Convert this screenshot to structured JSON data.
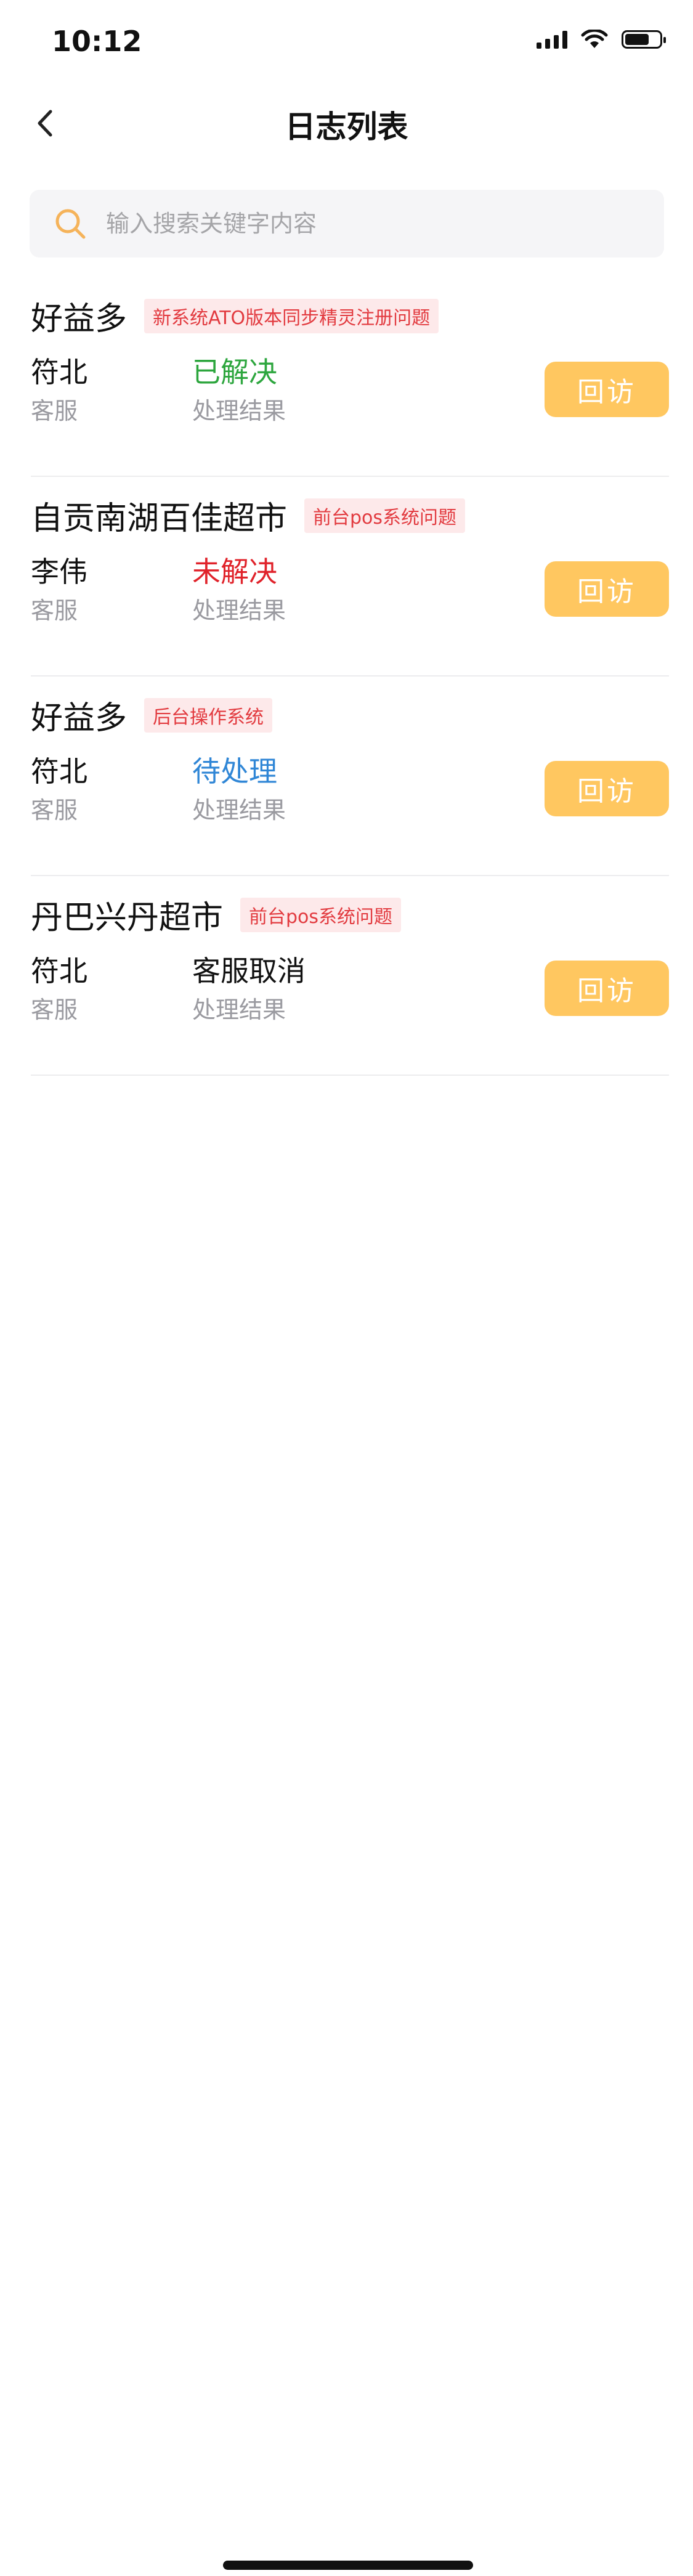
{
  "status_bar": {
    "time": "10:12",
    "battery_level": 0.7
  },
  "nav": {
    "title": "日志列表",
    "back_icon": "chevron-left-icon"
  },
  "search": {
    "placeholder": "输入搜索关键字内容",
    "value": "",
    "icon": "search-icon",
    "icon_color": "#F5B35A"
  },
  "colors": {
    "accent": "#FFC760",
    "tag_bg": "#FDE9EA",
    "tag_text": "#E23A3F",
    "status_resolved": "#2DA63E",
    "status_unresolved": "#E0222A",
    "status_pending": "#2F86D6",
    "status_cancelled": "#111111"
  },
  "items": [
    {
      "store": "好益多",
      "tag": "新系统ATO版本同步精灵注册问题",
      "staff": "符北",
      "staff_label": "客服",
      "result": "已解决",
      "result_label": "处理结果",
      "result_color": "#2DA63E",
      "button_label": "回访"
    },
    {
      "store": "自贡南湖百佳超市",
      "tag": "前台pos系统问题",
      "staff": "李伟",
      "staff_label": "客服",
      "result": "未解决",
      "result_label": "处理结果",
      "result_color": "#E0222A",
      "button_label": "回访"
    },
    {
      "store": "好益多",
      "tag": "后台操作系统",
      "staff": "符北",
      "staff_label": "客服",
      "result": "待处理",
      "result_label": "处理结果",
      "result_color": "#2F86D6",
      "button_label": "回访"
    },
    {
      "store": "丹巴兴丹超市",
      "tag": "前台pos系统问题",
      "staff": "符北",
      "staff_label": "客服",
      "result": "客服取消",
      "result_label": "处理结果",
      "result_color": "#111111",
      "button_label": "回访"
    }
  ]
}
